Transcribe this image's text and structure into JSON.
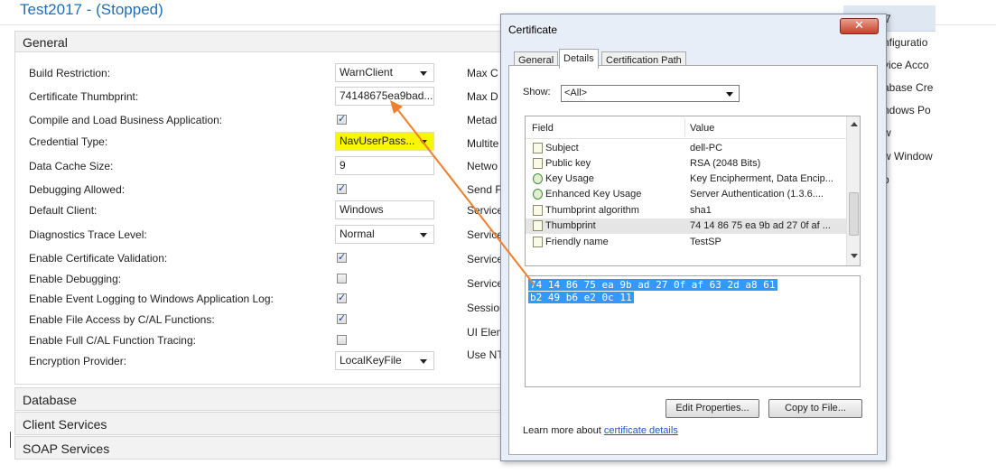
{
  "window_title": "Test2017 - (Stopped)",
  "general": {
    "header": "General",
    "fields": [
      {
        "label": "Build Restriction:",
        "kind": "dropdown",
        "value": "WarnClient"
      },
      {
        "label": "Certificate Thumbprint:",
        "kind": "text",
        "value": "74148675ea9bad..."
      },
      {
        "label": "Compile and Load Business Application:",
        "kind": "checkbox",
        "checked": true
      },
      {
        "label": "Credential Type:",
        "kind": "dropdown",
        "value": "NavUserPass...",
        "highlighted": true
      },
      {
        "label": "Data Cache Size:",
        "kind": "text",
        "value": "9"
      },
      {
        "label": "Debugging Allowed:",
        "kind": "checkbox",
        "checked": true
      },
      {
        "label": "Default Client:",
        "kind": "text",
        "value": "Windows"
      },
      {
        "label": "Diagnostics Trace Level:",
        "kind": "dropdown",
        "value": "Normal"
      },
      {
        "label": "Enable Certificate Validation:",
        "kind": "checkbox",
        "checked": true
      },
      {
        "label": "Enable Debugging:",
        "kind": "checkbox",
        "checked": false
      },
      {
        "label": "Enable Event Logging to Windows Application Log:",
        "kind": "checkbox",
        "checked": true
      },
      {
        "label": "Enable File Access by C/AL Functions:",
        "kind": "checkbox",
        "checked": true
      },
      {
        "label": "Enable Full C/AL Function Tracing:",
        "kind": "checkbox",
        "checked": false
      },
      {
        "label": "Encryption Provider:",
        "kind": "dropdown",
        "value": "LocalKeyFile"
      }
    ],
    "column2_labels": [
      "Max C",
      "Max D",
      "Metad",
      "Multite",
      "Netwo",
      "Send F",
      "Service",
      "Service",
      "Service",
      "Service",
      "Session",
      "UI Elem",
      "Use NT"
    ]
  },
  "sections": [
    "Database",
    "Client Services",
    "SOAP Services"
  ],
  "right_panel_items": [
    "7",
    "nfiguratio",
    "vice Acco",
    "abase Cre",
    "ndows Po",
    "w",
    "w Window",
    "p"
  ],
  "cert_dialog": {
    "title": "Certificate",
    "close_glyph": "✕",
    "tabs": [
      "General",
      "Details",
      "Certification Path"
    ],
    "active_tab": "Details",
    "show_label": "Show:",
    "show_value": "<All>",
    "columns": [
      "Field",
      "Value"
    ],
    "rows": [
      {
        "field": "Subject",
        "value": "dell-PC",
        "icon": "doc-icon"
      },
      {
        "field": "Public key",
        "value": "RSA (2048 Bits)",
        "icon": "doc-icon"
      },
      {
        "field": "Key Usage",
        "value": "Key Encipherment, Data Encip...",
        "icon": "key-usage-icon"
      },
      {
        "field": "Enhanced Key Usage",
        "value": "Server Authentication (1.3.6....",
        "icon": "key-usage-icon"
      },
      {
        "field": "Thumbprint algorithm",
        "value": "sha1",
        "icon": "doc-icon"
      },
      {
        "field": "Thumbprint",
        "value": "74 14 86 75 ea 9b ad 27 0f af ...",
        "icon": "doc-icon",
        "selected": true
      },
      {
        "field": "Friendly name",
        "value": "TestSP",
        "icon": "doc-icon"
      }
    ],
    "detail_lines": [
      "74 14 86 75 ea 9b ad 27 0f af 63 2d a8 61",
      "b2 49 b6 e2 0c 11"
    ],
    "buttons": {
      "edit": "Edit Properties...",
      "copy": "Copy to File..."
    },
    "learn_prefix": "Learn more about ",
    "learn_link": "certificate details"
  },
  "colors": {
    "title": "#1e6fb8",
    "highlight": "#f7f700",
    "arrow": "#ee7f2d",
    "selection": "#3399ff"
  }
}
